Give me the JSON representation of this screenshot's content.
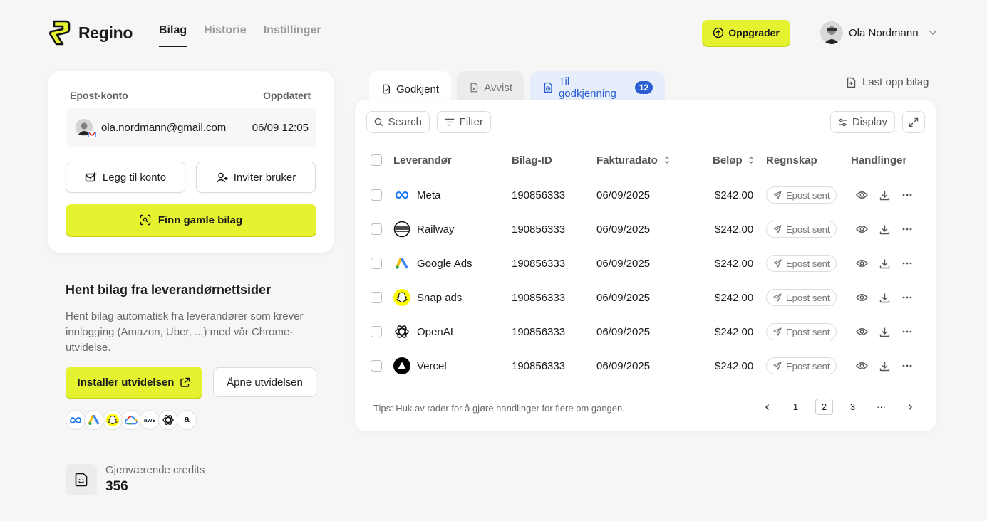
{
  "brand": {
    "name": "Regino"
  },
  "nav": {
    "items": [
      {
        "label": "Bilag"
      },
      {
        "label": "Historie"
      },
      {
        "label": "Instillinger"
      }
    ]
  },
  "header": {
    "upgrade_label": "Oppgrader",
    "user_name": "Ola Nordmann"
  },
  "account_card": {
    "col_account": "Epost-konto",
    "col_updated": "Oppdatert",
    "email": "ola.nordmann@gmail.com",
    "updated": "06/09 12:05",
    "add_account_label": "Legg til konto",
    "invite_user_label": "Inviter bruker",
    "find_old_label": "Finn gamle bilag"
  },
  "extension": {
    "title": "Hent bilag fra leverandørnettsider",
    "description": "Hent bilag automatisk fra leverandører som krever innlogging (Amazon, Uber, ...) med vår Chrome-utvidelse.",
    "install_label": "Installer utvidelsen",
    "open_label": "Åpne utvidelsen",
    "logos": [
      "meta-logo",
      "google-ads-logo",
      "snapchat-logo",
      "google-cloud-logo",
      "aws-logo",
      "openai-logo",
      "amazon-logo"
    ],
    "aws_text": "aws",
    "amazon_text": "a"
  },
  "credits": {
    "label": "Gjenværende credits",
    "value": "356"
  },
  "tabs": {
    "approved": "Godkjent",
    "rejected": "Avvist",
    "pending": "Til godkjenning",
    "pending_count": "12",
    "upload": "Last opp bilag"
  },
  "toolbar": {
    "search": "Search",
    "filter": "Filter",
    "display": "Display"
  },
  "table": {
    "headers": {
      "vendor": "Leverandør",
      "id": "Bilag-ID",
      "date": "Fakturadato",
      "amount": "Beløp",
      "accounting": "Regnskap",
      "actions": "Handlinger"
    },
    "rows": [
      {
        "vendor": "Meta",
        "icon": "meta-icon",
        "id": "190856333",
        "date": "06/09/2025",
        "amount": "$242.00",
        "status": "Epost sent"
      },
      {
        "vendor": "Railway",
        "icon": "railway-icon",
        "id": "190856333",
        "date": "06/09/2025",
        "amount": "$242.00",
        "status": "Epost sent"
      },
      {
        "vendor": "Google Ads",
        "icon": "google-ads-icon",
        "id": "190856333",
        "date": "06/09/2025",
        "amount": "$242.00",
        "status": "Epost sent"
      },
      {
        "vendor": "Snap ads",
        "icon": "snapchat-icon",
        "id": "190856333",
        "date": "06/09/2025",
        "amount": "$242.00",
        "status": "Epost sent"
      },
      {
        "vendor": "OpenAI",
        "icon": "openai-icon",
        "id": "190856333",
        "date": "06/09/2025",
        "amount": "$242.00",
        "status": "Epost sent"
      },
      {
        "vendor": "Vercel",
        "icon": "vercel-icon",
        "id": "190856333",
        "date": "06/09/2025",
        "amount": "$242.00",
        "status": "Epost sent"
      }
    ]
  },
  "footer": {
    "tip": "Tips: Huk av rader for å gjøre handlinger for flere om gangen.",
    "pages": [
      "1",
      "2",
      "3",
      "···"
    ],
    "current_page": "2"
  },
  "colors": {
    "accent": "#e5f230",
    "pending_blue": "#2d5fd3",
    "background": "#f6f6f6"
  }
}
